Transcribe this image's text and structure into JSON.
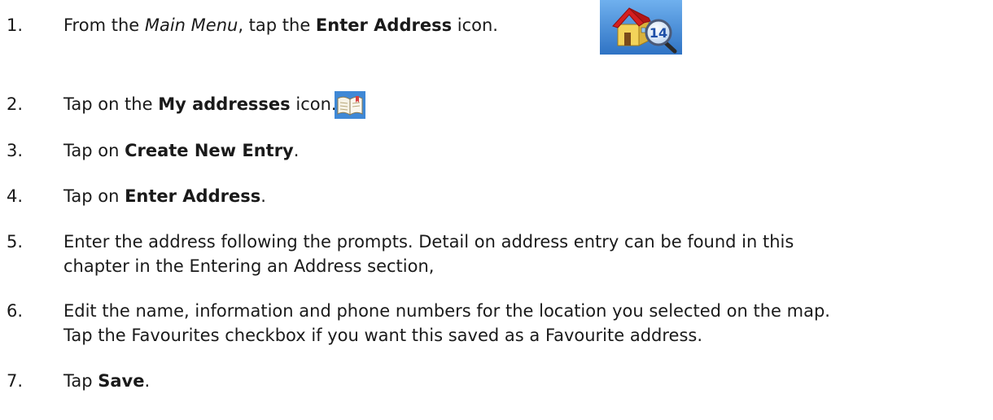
{
  "steps": [
    {
      "number": "1.",
      "parts": [
        "From the ",
        "Main Menu",
        ", tap the ",
        "Enter Address",
        " icon."
      ]
    },
    {
      "number": "2.",
      "parts": [
        "Tap on the ",
        "My addresses",
        " icon."
      ]
    },
    {
      "number": "3.",
      "parts": [
        "Tap on ",
        "Create New Entry",
        "."
      ]
    },
    {
      "number": "4.",
      "parts": [
        "Tap on ",
        "Enter Address",
        "."
      ]
    },
    {
      "number": "5.",
      "line1": "Enter the address following the prompts.  Detail on address entry can be found in this",
      "line2": "chapter in the Entering an Address section,"
    },
    {
      "number": "6.",
      "line1": "Edit the name, information and phone numbers for the location you selected on the map.",
      "line2": "Tap the Favourites checkbox if you want this saved as a Favourite address."
    },
    {
      "number": "7.",
      "parts": [
        "Tap ",
        "Save",
        "."
      ]
    }
  ],
  "icons": {
    "enter_address": "house-magnifier-icon",
    "my_addresses": "address-book-icon",
    "house_badge": "14"
  },
  "colors": {
    "icon_bg": "#4a8ed8",
    "roof": "#d41f1f",
    "house_wall": "#f3d35a"
  }
}
